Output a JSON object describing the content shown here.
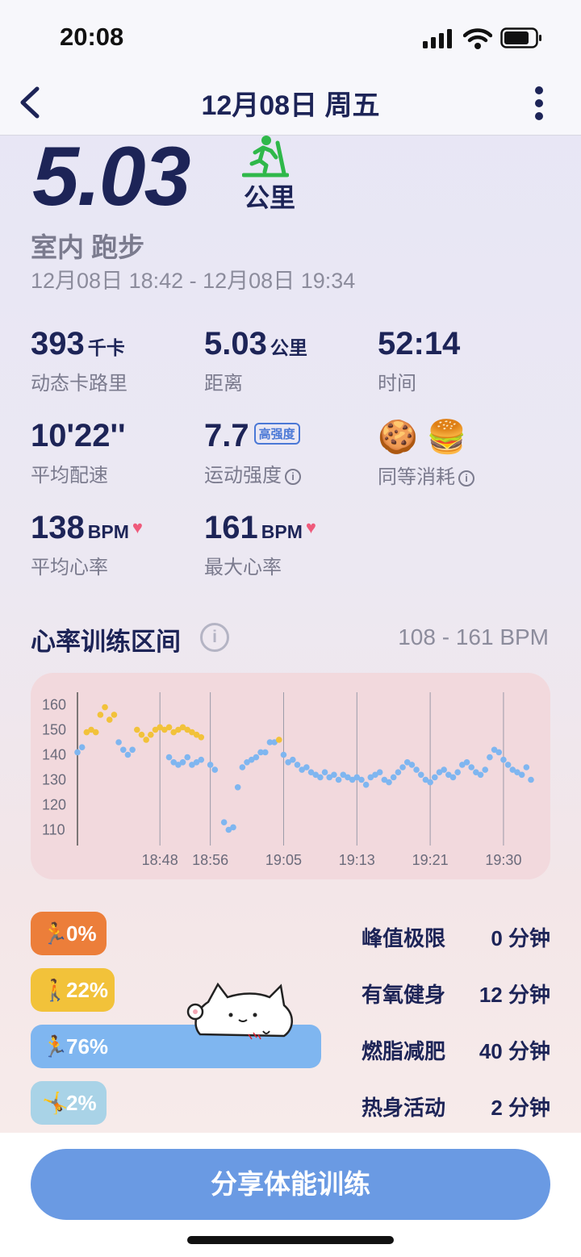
{
  "status_bar": {
    "time": "20:08"
  },
  "nav": {
    "title": "12月08日 周五"
  },
  "summary": {
    "distance": "5.03",
    "distance_unit": "公里",
    "workout_type": "室内 跑步",
    "time_range": "12月08日 18:42 - 12月08日 19:34"
  },
  "stats": {
    "calories": {
      "value": "393",
      "unit": "千卡",
      "label": "动态卡路里"
    },
    "distance": {
      "value": "5.03",
      "unit": "公里",
      "label": "距离"
    },
    "duration": {
      "value": "52:14",
      "label": "时间"
    },
    "pace": {
      "value": "10'22''",
      "label": "平均配速"
    },
    "intensity": {
      "value": "7.7",
      "tag": "高强度",
      "label": "运动强度"
    },
    "equivalent": {
      "foods": "🍪 🍔",
      "label": "同等消耗"
    },
    "avg_hr": {
      "value": "138",
      "unit": "BPM",
      "label": "平均心率"
    },
    "max_hr": {
      "value": "161",
      "unit": "BPM",
      "label": "最大心率"
    }
  },
  "zones_header": {
    "title": "心率训练区间",
    "range": "108 - 161 BPM"
  },
  "chart_data": {
    "type": "scatter",
    "y_ticks": [
      "160",
      "150",
      "140",
      "130",
      "120",
      "110"
    ],
    "x_ticks": [
      "18:48",
      "18:56",
      "19:05",
      "19:13",
      "19:21",
      "19:30"
    ],
    "ylim": [
      105,
      165
    ],
    "colors": {
      "fat_burn": "#7fb6f0",
      "aerobic": "#f2c23a"
    },
    "series": [
      {
        "name": "燃脂减肥",
        "color": "#7fb6f0",
        "points": [
          [
            0,
            141
          ],
          [
            1,
            143
          ],
          [
            9,
            145
          ],
          [
            10,
            142
          ],
          [
            11,
            140
          ],
          [
            12,
            142
          ],
          [
            20,
            139
          ],
          [
            21,
            137
          ],
          [
            22,
            136
          ],
          [
            23,
            137
          ],
          [
            24,
            139
          ],
          [
            25,
            136
          ],
          [
            26,
            137
          ],
          [
            27,
            138
          ],
          [
            29,
            136
          ],
          [
            30,
            134
          ],
          [
            32,
            113
          ],
          [
            33,
            110
          ],
          [
            34,
            111
          ],
          [
            35,
            127
          ],
          [
            36,
            135
          ],
          [
            37,
            137
          ],
          [
            38,
            138
          ],
          [
            39,
            139
          ],
          [
            40,
            141
          ],
          [
            41,
            141
          ],
          [
            42,
            145
          ],
          [
            43,
            145
          ],
          [
            45,
            140
          ],
          [
            46,
            137
          ],
          [
            47,
            138
          ],
          [
            48,
            136
          ],
          [
            49,
            134
          ],
          [
            50,
            135
          ],
          [
            51,
            133
          ],
          [
            52,
            132
          ],
          [
            53,
            131
          ],
          [
            54,
            133
          ],
          [
            55,
            131
          ],
          [
            56,
            132
          ],
          [
            57,
            130
          ],
          [
            58,
            132
          ],
          [
            59,
            131
          ],
          [
            60,
            130
          ],
          [
            61,
            131
          ],
          [
            62,
            130
          ],
          [
            63,
            128
          ],
          [
            64,
            131
          ],
          [
            65,
            132
          ],
          [
            66,
            133
          ],
          [
            67,
            130
          ],
          [
            68,
            129
          ],
          [
            69,
            131
          ],
          [
            70,
            133
          ],
          [
            71,
            135
          ],
          [
            72,
            137
          ],
          [
            73,
            136
          ],
          [
            74,
            134
          ],
          [
            75,
            132
          ],
          [
            76,
            130
          ],
          [
            77,
            129
          ],
          [
            78,
            131
          ],
          [
            79,
            133
          ],
          [
            80,
            134
          ],
          [
            81,
            132
          ],
          [
            82,
            131
          ],
          [
            83,
            133
          ],
          [
            84,
            136
          ],
          [
            85,
            137
          ],
          [
            86,
            135
          ],
          [
            87,
            133
          ],
          [
            88,
            132
          ],
          [
            89,
            134
          ],
          [
            90,
            139
          ],
          [
            91,
            142
          ],
          [
            92,
            141
          ],
          [
            93,
            138
          ],
          [
            94,
            136
          ],
          [
            95,
            134
          ],
          [
            96,
            133
          ],
          [
            97,
            132
          ],
          [
            98,
            135
          ],
          [
            99,
            130
          ]
        ]
      },
      {
        "name": "有氧健身",
        "color": "#f2c23a",
        "points": [
          [
            2,
            149
          ],
          [
            3,
            150
          ],
          [
            4,
            149
          ],
          [
            5,
            156
          ],
          [
            6,
            159
          ],
          [
            7,
            154
          ],
          [
            8,
            156
          ],
          [
            13,
            150
          ],
          [
            14,
            148
          ],
          [
            15,
            146
          ],
          [
            16,
            148
          ],
          [
            17,
            150
          ],
          [
            18,
            151
          ],
          [
            19,
            150
          ],
          [
            20,
            151
          ],
          [
            21,
            149
          ],
          [
            22,
            150
          ],
          [
            23,
            151
          ],
          [
            24,
            150
          ],
          [
            25,
            149
          ],
          [
            26,
            148
          ],
          [
            27,
            147
          ],
          [
            44,
            146
          ]
        ]
      }
    ]
  },
  "zones": [
    {
      "percent": "0%",
      "name": "峰值极限",
      "minutes": "0 分钟",
      "fraction": 0.0,
      "color": "#ec7e3a"
    },
    {
      "percent": "22%",
      "name": "有氧健身",
      "minutes": "12 分钟",
      "fraction": 0.22,
      "color": "#f2c23a"
    },
    {
      "percent": "76%",
      "name": "燃脂减肥",
      "minutes": "40 分钟",
      "fraction": 0.76,
      "color": "#7fb6f0"
    },
    {
      "percent": "2%",
      "name": "热身活动",
      "minutes": "2 分钟",
      "fraction": 0.02,
      "color": "#a9d3e7"
    }
  ],
  "share_button": {
    "label": "分享体能训练"
  }
}
